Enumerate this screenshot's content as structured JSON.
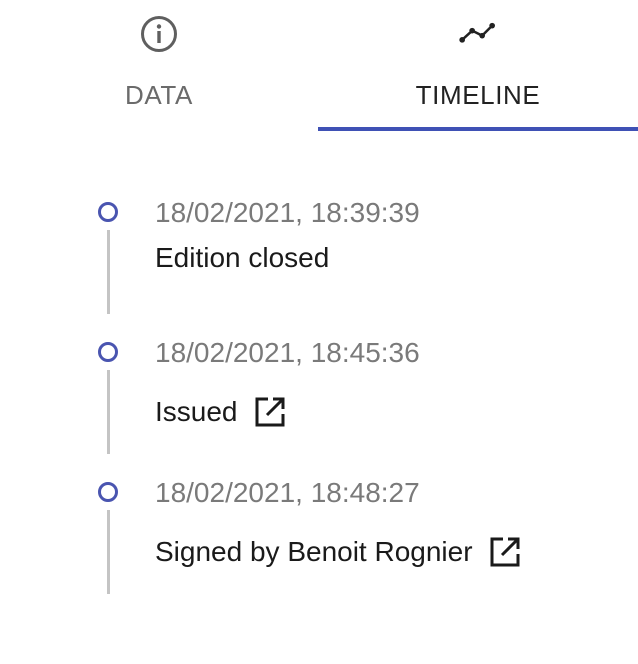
{
  "tabs": [
    {
      "label": "DATA",
      "icon": "info-icon",
      "active": false
    },
    {
      "label": "TIMELINE",
      "icon": "timeline-icon",
      "active": true
    }
  ],
  "timeline": {
    "events": [
      {
        "timestamp": "18/02/2021, 18:39:39",
        "title": "Edition closed",
        "has_link": false
      },
      {
        "timestamp": "18/02/2021, 18:45:36",
        "title": "Issued",
        "has_link": true,
        "link_icon": "open-in-new-icon"
      },
      {
        "timestamp": "18/02/2021, 18:48:27",
        "title": "Signed by Benoit Rognier",
        "has_link": true,
        "link_icon": "open-in-new-icon"
      }
    ]
  },
  "colors": {
    "accent": "#3f51b5",
    "dot": "#4a55b0",
    "connector": "#c4c4c4",
    "timestamp": "#7a7a7a",
    "text": "#1a1a1a",
    "inactive_tab": "#6b6b6b"
  }
}
